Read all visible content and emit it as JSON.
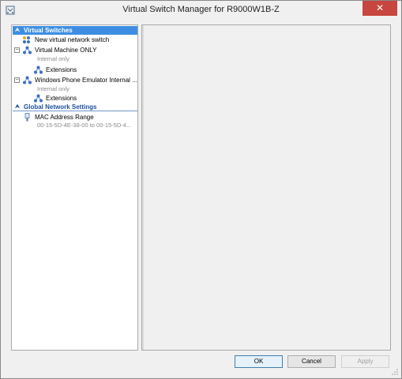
{
  "window": {
    "title": "Virtual Switch Manager for R9000W1B-Z",
    "close_glyph": "✕"
  },
  "tree": {
    "virtual_switches_header": "Virtual Switches",
    "new_switch": "New virtual network switch",
    "switch1": {
      "name": "Virtual Machine ONLY",
      "detail": "Internal only",
      "extensions": "Extensions"
    },
    "switch2": {
      "name": "Windows Phone Emulator Internal ...",
      "detail": "Internal only",
      "extensions": "Extensions"
    },
    "global_header": "Global Network Settings",
    "mac_range": {
      "name": "MAC Address Range",
      "detail": "00-15-5D-4E-38-00 to 00-15-5D-4..."
    }
  },
  "buttons": {
    "ok": "OK",
    "cancel": "Cancel",
    "apply": "Apply"
  },
  "colors": {
    "selection": "#3d8ee3",
    "close": "#c7463d",
    "section_text": "#1a4f9c"
  },
  "icons": {
    "app": "switch-manager-icon",
    "collapse": "double-chevron-up-icon",
    "network": "network-switch-icon",
    "new_switch": "new-switch-icon",
    "mac": "mac-address-icon"
  }
}
